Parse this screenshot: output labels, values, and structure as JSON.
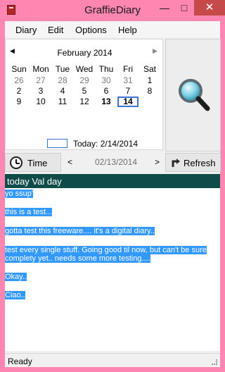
{
  "window": {
    "title": "GraffieDiary",
    "min_glyph": "—",
    "max_glyph": "□",
    "close_glyph": "✕",
    "frame_color": "#ff86b1",
    "close_color": "#c74a4a"
  },
  "menu": [
    {
      "label": "Diary"
    },
    {
      "label": "Edit"
    },
    {
      "label": "Options"
    },
    {
      "label": "Help"
    }
  ],
  "calendar": {
    "month_label": "February 2014",
    "prev_glyph": "◀",
    "next_glyph": "▶",
    "weekdays": [
      "Sun",
      "Mon",
      "Tue",
      "Wed",
      "Thu",
      "Fri",
      "Sat"
    ],
    "weeks": [
      [
        "26",
        "27",
        "28",
        "29",
        "30",
        "31",
        "1"
      ],
      [
        "2",
        "3",
        "4",
        "5",
        "6",
        "7",
        "8"
      ],
      [
        "9",
        "10",
        "11",
        "12",
        "13",
        "14",
        ""
      ]
    ],
    "other_month_days": [
      "26",
      "27",
      "28",
      "29",
      "30",
      "31"
    ],
    "bold_days": [
      "13",
      "14"
    ],
    "selected_day": "14",
    "today_label": "Today: 2/14/2014",
    "accent_color": "#3b73d5"
  },
  "search_button": {
    "icon": "magnifier-icon"
  },
  "time_button": {
    "label": "Time",
    "icon": "clock-icon"
  },
  "date_nav": {
    "prev_glyph": "<",
    "date": "02/13/2014",
    "next_glyph": ">"
  },
  "refresh_button": {
    "label": "Refresh",
    "icon": "refresh-arrow-icon"
  },
  "entry": {
    "title": "today Val day",
    "title_bar_color": "#0f4b49",
    "selection_color": "#3399ff",
    "lines": [
      "yo ssup'",
      "this is a test...",
      "gotta test this freeware.... it's a digital diary..",
      "test every single stuff. Going good til now, but can't be sure",
      "complety yet.. needs some more testing....",
      "Okay..",
      "Ciao.."
    ]
  },
  "status": {
    "text": "Ready"
  }
}
